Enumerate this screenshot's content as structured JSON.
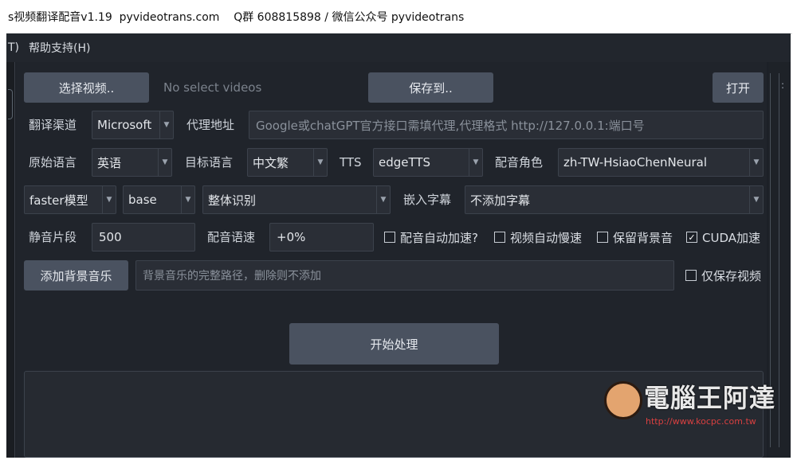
{
  "window": {
    "title": "s视频翻译配音v1.19  pyvideotrans.com    Q群 608815898 / 微信公众号 pyvideotrans"
  },
  "menubar": {
    "items": [
      {
        "label": "T)"
      },
      {
        "label": "帮助支持(H)"
      }
    ]
  },
  "toolbar": {
    "select_video_label": "选择视频..",
    "no_video_text": "No select videos",
    "save_to_label": "保存到..",
    "open_label": "打开"
  },
  "row1": {
    "translate_channel_label": "翻译渠道",
    "translate_channel_value": "Microsoft",
    "proxy_label": "代理地址",
    "proxy_placeholder": "Google或chatGPT官方接口需填代理,代理格式 http://127.0.0.1:端口号"
  },
  "row2": {
    "source_lang_label": "原始语言",
    "source_lang_value": "英语",
    "target_lang_label": "目标语言",
    "target_lang_value": "中文繁",
    "tts_label": "TTS",
    "tts_value": "edgeTTS",
    "voice_role_label": "配音角色",
    "voice_role_value": "zh-TW-HsiaoChenNeural"
  },
  "row3": {
    "model_type_value": "faster模型",
    "model_value": "base",
    "recognition_value": "整体识别",
    "embed_subtitle_label": "嵌入字幕",
    "embed_subtitle_value": "不添加字幕"
  },
  "row4": {
    "silence_label": "静音片段",
    "silence_value": "500",
    "voice_rate_label": "配音语速",
    "voice_rate_value": "+0%",
    "auto_speedup_label": "配音自动加速?",
    "auto_speedup_checked": false,
    "video_autoslow_label": "视频自动慢速",
    "video_autoslow_checked": false,
    "keep_bg_label": "保留背景音",
    "keep_bg_checked": false,
    "cuda_label": "CUDA加速",
    "cuda_checked": true
  },
  "row5": {
    "add_bg_music_label": "添加背景音乐",
    "bg_music_placeholder": "背景音乐的完整路径，删除则不添加",
    "only_save_video_label": "仅保存视频",
    "only_save_video_checked": false
  },
  "actions": {
    "start_label": "开始处理"
  },
  "watermark": {
    "title": "電腦王阿達",
    "url": "http://www.kocpc.com.tw"
  },
  "icons": {
    "dropdown": "chevron-down-icon",
    "check": "checkmark-icon"
  }
}
